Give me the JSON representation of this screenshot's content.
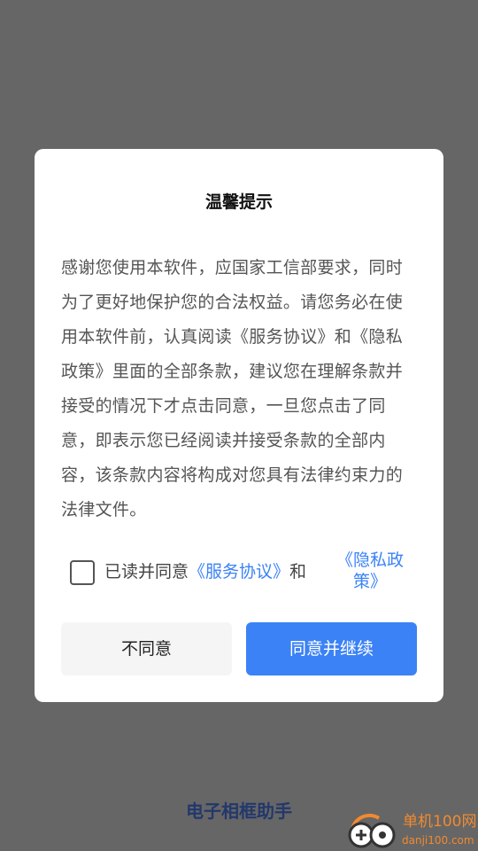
{
  "dialog": {
    "title": "温馨提示",
    "body": "感谢您使用本软件，应国家工信部要求，同时为了更好地保护您的合法权益。请您务必在使用本软件前，认真阅读《服务协议》和《隐私政策》里面的全部条款，建议您在理解条款并接受的情况下才点击同意，一旦您点击了同意，即表示您已经阅读并接受条款的全部内容，该条款内容将构成对您具有法律约束力的法律文件。",
    "agree_prefix": "已读并同意",
    "service_link": "《服务协议》",
    "and_text": "和",
    "privacy_link_line1": "《隐私政",
    "privacy_link_line2": "策》",
    "decline_label": "不同意",
    "accept_label": "同意并继续",
    "checkbox_checked": false
  },
  "app": {
    "name": "电子相框助手"
  },
  "watermark": {
    "site_name": "单机100网",
    "site_url": "danji100.com"
  },
  "colors": {
    "overlay": "#666666",
    "accent": "#3b82f6",
    "app_name": "#23386b",
    "watermark": "#f28a2f"
  }
}
